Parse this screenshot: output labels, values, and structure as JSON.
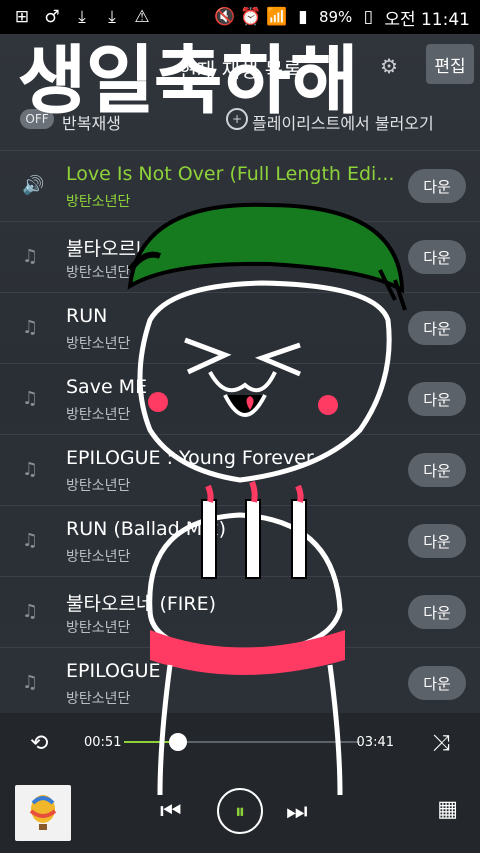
{
  "status": {
    "battery": "89%",
    "time": "오전 11:41"
  },
  "header": {
    "title": "현재 재생 목록",
    "edit_label": "편집"
  },
  "subbar": {
    "toggle": "OFF",
    "repeat_label": "반복재생",
    "load_label": "플레이리스트에서 불러오기"
  },
  "rows": [
    {
      "title": "Love Is Not Over (Full Length Edi...",
      "artist": "방탄소년단",
      "button": "다운",
      "playing": true
    },
    {
      "title": "불타오르네",
      "artist": "방탄소년단",
      "button": "다운"
    },
    {
      "title": "RUN",
      "artist": "방탄소년단",
      "button": "다운"
    },
    {
      "title": "Save ME",
      "artist": "방탄소년단",
      "button": "다운"
    },
    {
      "title": "EPILOGUE : Young Forever",
      "artist": "방탄소년단",
      "button": "다운"
    },
    {
      "title": "RUN (Ballad Mix)",
      "artist": "방탄소년단",
      "button": "다운"
    },
    {
      "title": "불타오르네 (FIRE)",
      "artist": "방탄소년단",
      "button": "다운"
    },
    {
      "title": "EPILOGUE",
      "artist": "방탄소년단",
      "button": "다운"
    }
  ],
  "player": {
    "current_time": "00:51",
    "total_time": "03:41",
    "progress": 0.23
  },
  "overlay": {
    "text": "생일축하해",
    "colors": {
      "hat": "#167a1f",
      "cake_band": "#ff3a63",
      "stroke": "#000000",
      "white": "#ffffff"
    }
  }
}
